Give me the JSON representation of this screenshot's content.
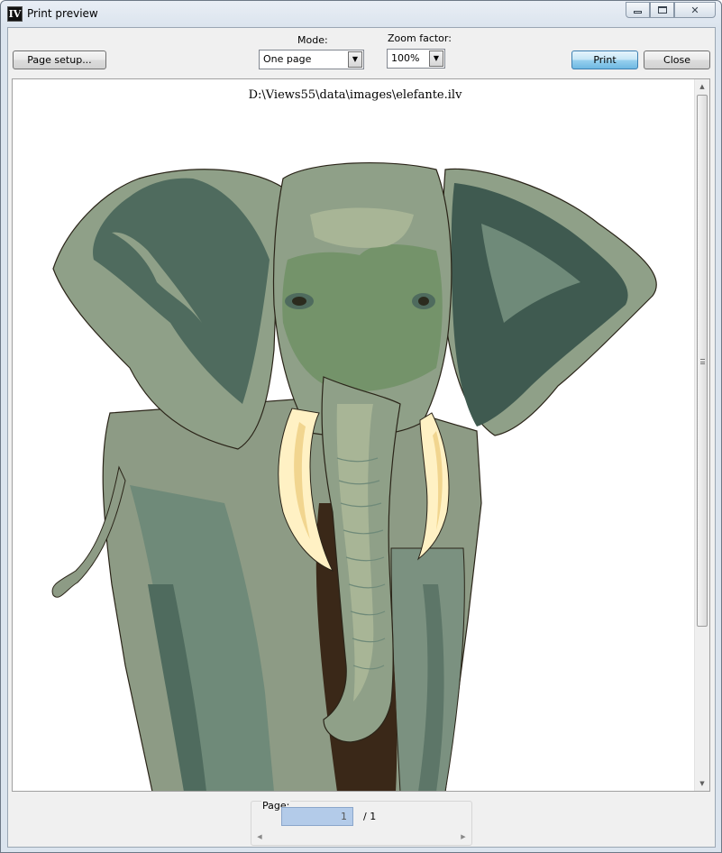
{
  "window": {
    "title": "Print preview",
    "app_icon_text": "IV"
  },
  "toolbar": {
    "page_setup_label": "Page setup...",
    "mode_label": "Mode:",
    "mode_value": "One page",
    "zoom_label": "Zoom factor:",
    "zoom_value": "100%",
    "print_label": "Print",
    "close_label": "Close"
  },
  "preview": {
    "file_path": "D:\\Views55\\data\\images\\elefante.ilv",
    "image_subject": "elephant illustration"
  },
  "footer": {
    "page_label": "Page:",
    "page_value": "1",
    "page_total": "/ 1"
  },
  "colors": {
    "elephant_light": "#8fa088",
    "elephant_mid": "#6f8a79",
    "elephant_dark": "#3f5a50",
    "elephant_face": "#74936a",
    "tusk": "#fff1c4",
    "trunk_shadow": "#3a2818",
    "outline": "#2a2418"
  }
}
